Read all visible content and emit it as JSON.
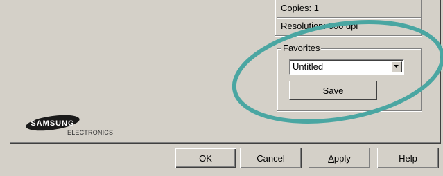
{
  "info": {
    "copies": "Copies: 1",
    "resolution": "Resolution: 600 dpi"
  },
  "favorites": {
    "legend": "Favorites",
    "selected": "Untitled",
    "save_label": "Save"
  },
  "logo": {
    "brand": "SAMSUNG",
    "sub": "ELECTRONICS"
  },
  "dialog_buttons": {
    "ok": "OK",
    "cancel": "Cancel",
    "apply_prefix": "",
    "apply_underlined": "A",
    "apply_rest": "pply",
    "help": "Help"
  },
  "annotation_color": "#4aa6a2"
}
